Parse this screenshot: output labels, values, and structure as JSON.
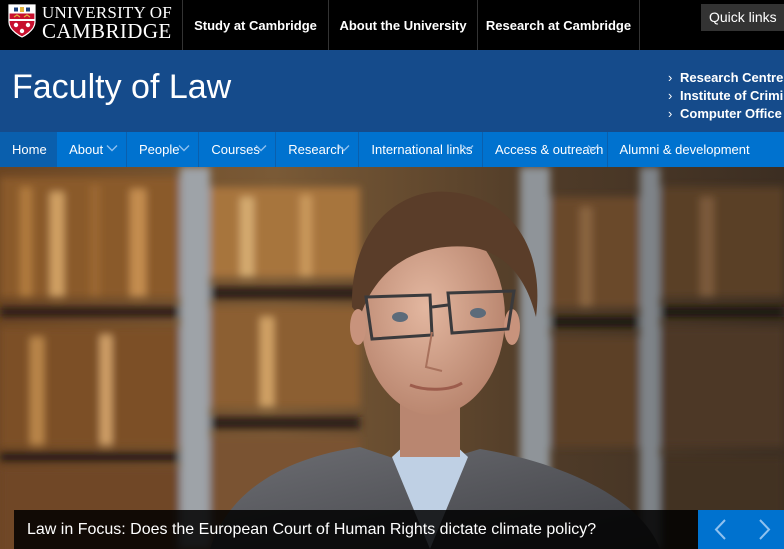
{
  "brand": {
    "line1": "UNIVERSITY OF",
    "line2": "CAMBRIDGE"
  },
  "topnav": {
    "items": [
      {
        "label": "Study at Cambridge"
      },
      {
        "label": "About the University"
      },
      {
        "label": "Research at Cambridge"
      }
    ],
    "quick_links": "Quick links"
  },
  "header": {
    "title": "Faculty of Law",
    "links": [
      {
        "label": "Research Centres"
      },
      {
        "label": "Institute of Criminology"
      },
      {
        "label": "Computer Office"
      }
    ]
  },
  "mainnav": {
    "items": [
      {
        "label": "Home",
        "active": true
      },
      {
        "label": "About"
      },
      {
        "label": "People"
      },
      {
        "label": "Courses"
      },
      {
        "label": "Research"
      },
      {
        "label": "International links"
      },
      {
        "label": "Access & outreach"
      },
      {
        "label": "Alumni & development"
      }
    ]
  },
  "hero": {
    "caption": "Law in Focus: Does the European Court of Human Rights dictate climate policy?"
  },
  "colors": {
    "header_blue": "#154b8b",
    "nav_blue": "#0072cf",
    "nav_active": "#0a5fad"
  }
}
